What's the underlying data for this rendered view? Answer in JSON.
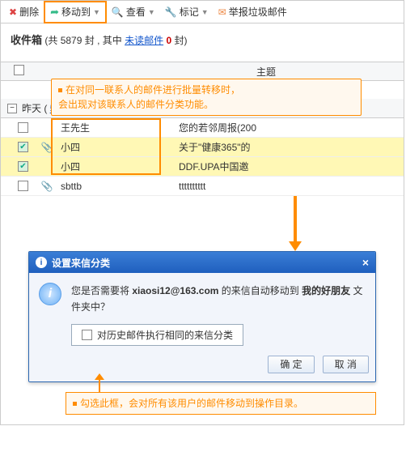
{
  "toolbar": {
    "delete": "删除",
    "move": "移动到",
    "view": "查看",
    "mark": "标记",
    "report": "举报垃圾邮件"
  },
  "inbox": {
    "title": "收件箱",
    "count_prefix": "(共 ",
    "count": "5879",
    "count_mid": " 封 , 其中 ",
    "unread_label": "未读邮件",
    "zero": "0",
    "count_suffix": " 封)"
  },
  "callout1_a": "在对同一联系人的邮件进行批量转移时，",
  "callout1_b": "会出现对该联系人的邮件分类功能。",
  "thead_subject": "主题",
  "group": {
    "label": "昨天",
    "linkcount": "5封"
  },
  "rows": [
    {
      "checked": false,
      "clip": false,
      "sender": "王先生",
      "subject": "您的若邻周报(200"
    },
    {
      "checked": true,
      "clip": true,
      "sender": "小四",
      "subject": "关于\"健康365\"的"
    },
    {
      "checked": true,
      "clip": false,
      "sender": "小四",
      "subject": "DDF.UPA中国邀"
    },
    {
      "checked": false,
      "clip": true,
      "sender": "sbttb",
      "subject": "tttttttttt"
    }
  ],
  "dialog": {
    "title": "设置来信分类",
    "msg_a": "您是否需要将 ",
    "email": "xiaosi12@163.com",
    "msg_b": " 的来信自动移动到 ",
    "folder": "我的好朋友",
    "msg_c": " 文件夹中？",
    "option": "对历史邮件执行相同的来信分类",
    "ok": "确 定",
    "cancel": "取 消"
  },
  "callout2": "勾选此框，会对所有该用户的邮件移动到操作目录。"
}
